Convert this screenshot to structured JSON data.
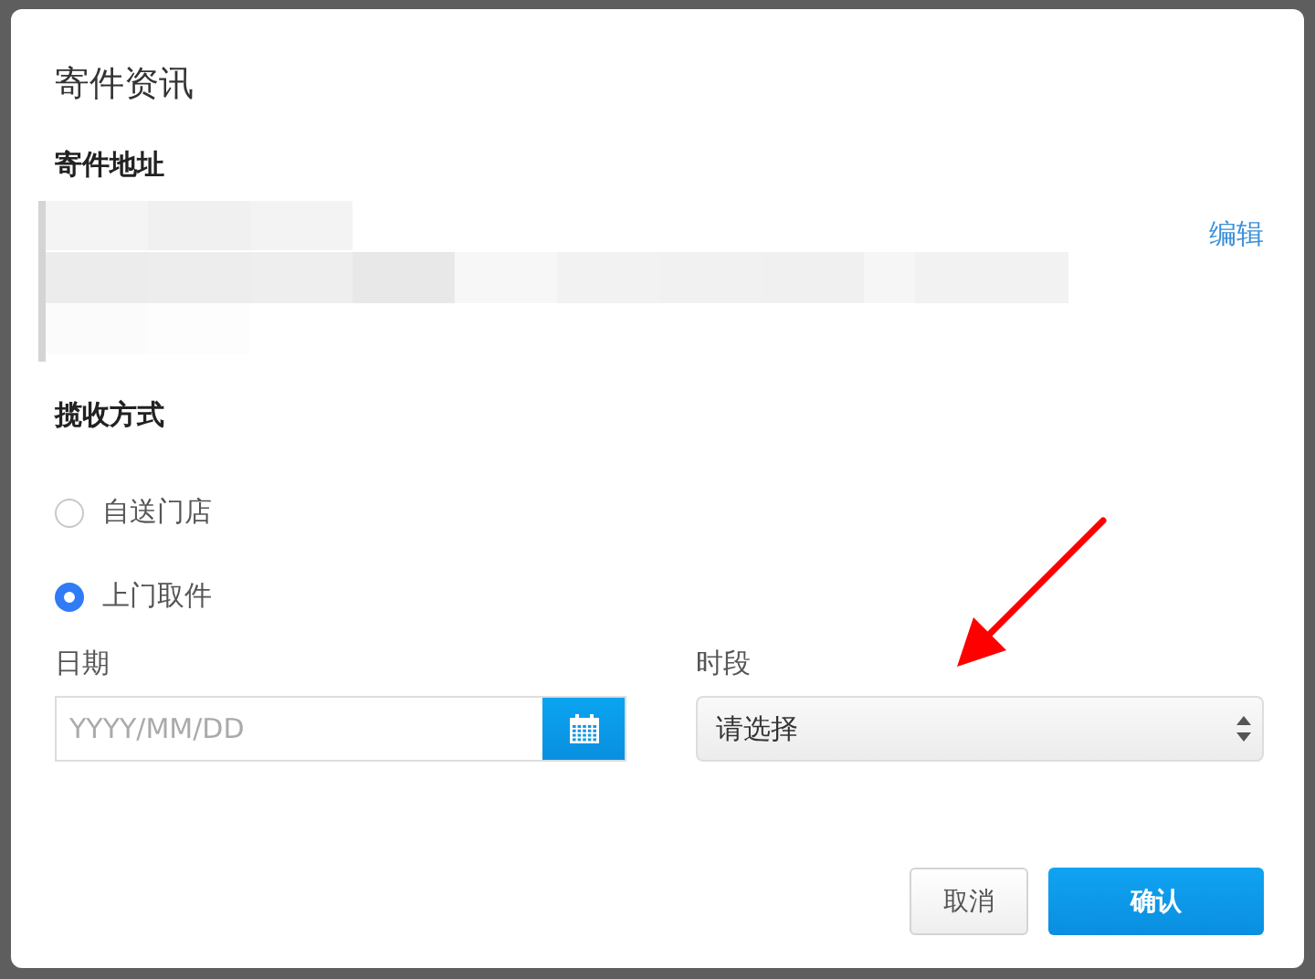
{
  "dialog": {
    "title": "寄件资讯",
    "address": {
      "label": "寄件地址",
      "edit_link": "编辑"
    },
    "pickup": {
      "label": "揽收方式",
      "options": [
        {
          "label": "自送门店",
          "selected": false
        },
        {
          "label": "上门取件",
          "selected": true
        }
      ]
    },
    "date": {
      "label": "日期",
      "placeholder": "YYYY/MM/DD"
    },
    "time_slot": {
      "label": "时段",
      "value": "请选择"
    },
    "buttons": [
      {
        "label": "取消",
        "kind": "secondary"
      },
      {
        "label": "确认",
        "kind": "primary"
      }
    ]
  }
}
